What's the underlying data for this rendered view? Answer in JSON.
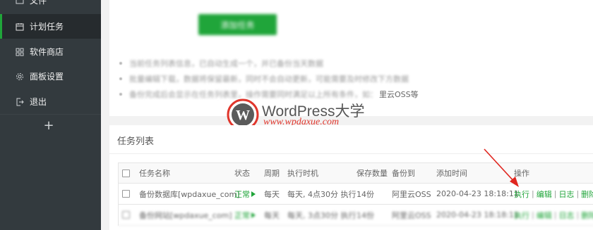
{
  "sidebar": {
    "items": [
      {
        "label": "文件",
        "icon": "folder-icon"
      },
      {
        "label": "计划任务",
        "icon": "calendar-icon",
        "active": true
      },
      {
        "label": "软件商店",
        "icon": "grid-icon"
      },
      {
        "label": "面板设置",
        "icon": "gear-icon"
      },
      {
        "label": "退出",
        "icon": "logout-icon"
      }
    ],
    "add_symbol": "+"
  },
  "top": {
    "button_label": "添加任务",
    "tips": [
      {
        "text": "当前任务列表信息，已自动生成一个，并已备份当天数据",
        "suffix": ""
      },
      {
        "text": "批量编辑下载，数据将保留最新，同时不会自动更新，可能需要及时修改下方数据",
        "suffix": ""
      },
      {
        "text": "备份完成后会显示在任务列表里，操作需要同时满足以上所有条件，如：",
        "suffix": "里云OSS等"
      }
    ]
  },
  "watermark": {
    "title": "WordPress大学",
    "url": "www.wpdaxue.com"
  },
  "tasks": {
    "title": "任务列表",
    "columns": [
      "任务名称",
      "状态",
      "周期",
      "执行时机",
      "保存数量",
      "备份到",
      "添加时间",
      "操作"
    ],
    "rows": [
      {
        "name": "备份数据库[wpdaxue_com]",
        "status": "正常",
        "cycle": "每天",
        "timing": "每天, 4点30分 执行",
        "keep": "14份",
        "backup_to": "阿里云OSS",
        "added": "2020-04-23 18:18:11",
        "ops": [
          "执行",
          "编辑",
          "日志",
          "删除"
        ]
      },
      {
        "name": "备份网站[wpdaxue_com]",
        "status": "正常",
        "cycle": "每天",
        "timing": "每天, 3点30分 执行",
        "keep": "14份",
        "backup_to": "阿里云OSS",
        "added": "2020-04-23 18:18:11",
        "ops": [
          "执行",
          "编辑",
          "日志",
          "删除"
        ]
      }
    ]
  },
  "colors": {
    "sidebar_bg": "#333a3e",
    "accent": "#20a53a",
    "arrow": "#e0261f"
  }
}
